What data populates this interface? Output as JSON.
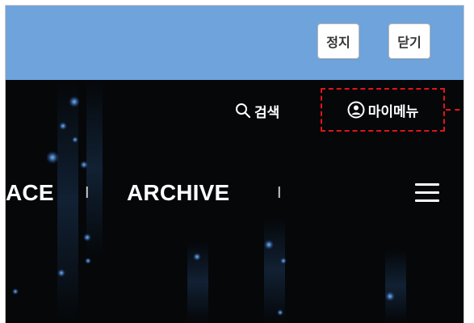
{
  "topbar": {
    "stop_label": "정지",
    "close_label": "닫기",
    "background_color": "#6fa3db"
  },
  "utility": {
    "search_label": "검색",
    "search_icon": "search-icon",
    "mymenu_label": "마이메뉴",
    "mymenu_icon": "user-circle-icon",
    "highlight_color": "#e3141c"
  },
  "nav": {
    "items": [
      {
        "label": "ACE"
      },
      {
        "label": "ARCHIVE"
      }
    ],
    "separator": "I",
    "menu_icon": "hamburger-menu-icon"
  }
}
